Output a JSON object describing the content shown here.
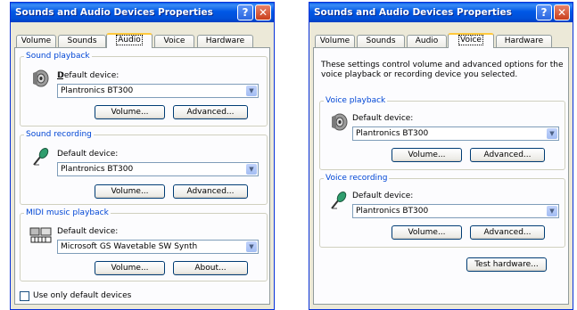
{
  "left_window": {
    "title": "Sounds and Audio Devices Properties",
    "tabs": [
      "Volume",
      "Sounds",
      "Audio",
      "Voice",
      "Hardware"
    ],
    "active_tab": "Audio",
    "playback": {
      "legend": "Sound playback",
      "device_label": "Default device:",
      "device_value": "Plantronics BT300",
      "volume_btn": "Volume...",
      "advanced_btn": "Advanced..."
    },
    "recording": {
      "legend": "Sound recording",
      "device_label": "Default device:",
      "device_value": "Plantronics BT300",
      "volume_btn": "Volume...",
      "advanced_btn": "Advanced..."
    },
    "midi": {
      "legend": "MIDI music playback",
      "device_label": "Default device:",
      "device_value": "Microsoft GS Wavetable SW Synth",
      "volume_btn": "Volume...",
      "about_btn": "About..."
    },
    "default_only_checkbox": "Use only default devices"
  },
  "right_window": {
    "title": "Sounds and Audio Devices Properties",
    "tabs": [
      "Volume",
      "Sounds",
      "Audio",
      "Voice",
      "Hardware"
    ],
    "active_tab": "Voice",
    "description": "These settings control volume and advanced options for the voice playback or recording device you selected.",
    "voice_playback": {
      "legend": "Voice playback",
      "device_label": "Default device:",
      "device_value": "Plantronics BT300",
      "volume_btn": "Volume...",
      "advanced_btn": "Advanced..."
    },
    "voice_recording": {
      "legend": "Voice recording",
      "device_label": "Default device:",
      "device_value": "Plantronics BT300",
      "volume_btn": "Volume...",
      "advanced_btn": "Advanced..."
    },
    "test_hardware_btn": "Test hardware..."
  },
  "icons": {
    "help": "help-icon",
    "close": "close-icon",
    "speaker": "speaker-icon",
    "microphone": "microphone-icon",
    "midi": "midi-keyboard-icon",
    "dropdown": "chevron-down-icon"
  },
  "colors": {
    "titlebar": "#0054e3",
    "group_legend": "#0046d5",
    "close_button": "#d4401c",
    "panel_bg": "#fcfcfe",
    "dialog_bg": "#ece9d8"
  }
}
